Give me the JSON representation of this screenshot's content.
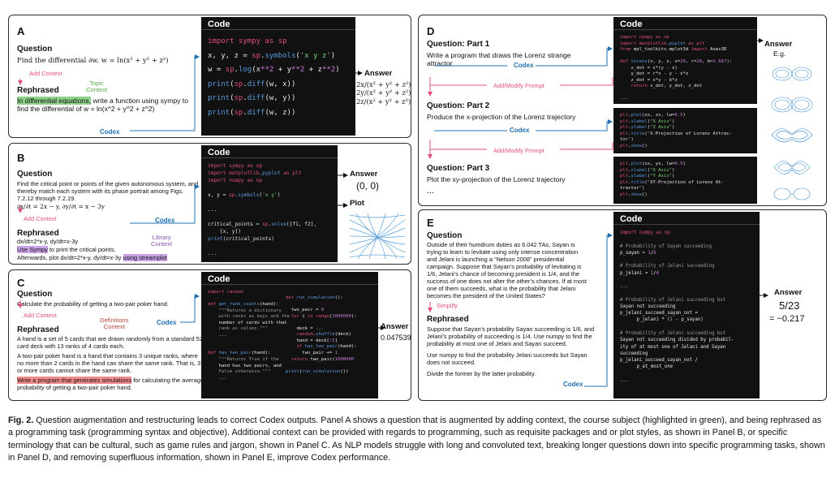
{
  "common": {
    "question": "Question",
    "rephrased": "Rephrased",
    "code": "Code",
    "answer": "Answer",
    "codex": "Codex",
    "add_context": "Add Context",
    "plot": "Plot"
  },
  "panelA": {
    "label": "A",
    "question": "Find the differential ∂w. w = ln(x² + y² + z²)",
    "topic": "Topic\nContext",
    "rephrased_hl": "In differential equations,",
    "rephrased_rest": " write a function using sympy to find the differential of w = ln(x^2 + y^2 + z^2)",
    "code": "import sympy as sp\nx, y, z = sp.symbols('x y z')\nw = sp.log(x**2 + y**2 + z**2)\nprint(sp.diff(w, x))\nprint(sp.diff(w, y))\nprint(sp.diff(w, z))",
    "answer": "2x/(x² + y² + z²)\n2y/(x² + y² + z²)\n2z/(x² + y² + z²)"
  },
  "panelB": {
    "label": "B",
    "question": "Find the critical point or points of the given autonomous system, and thereby match each system with its phase portrait among Figs. 7.2.12 through 7.2.19.",
    "equation": "∂x/∂t = 2x − y,  ∂y/∂t = x − 3y",
    "rephrased_1": "dx/dt=2*x-y, dy/dt=x-3y",
    "rephrased_hl1": "Use Sympy",
    "rephrased_2": " to print the critical points.",
    "rephrased_3": "Afterwards, plot dx/dt=2*x-y, dy/dt=x-3y ",
    "rephrased_hl2": "using streamplot",
    "library": "Library\nContext",
    "code": "import sympy as sp\nimport matplotlib.pyplot as plt\nimport numpy as np\n\nx, y = sp.symbols('x y')\n\n...\n\ncritical_points = sp.solve([f1, f2],\n    [x, y])\nprint(critical_points)\n\n...\n\nplt.streamplot(x_mesh, y_mesh, dx, dy)",
    "answer": "(0, 0)"
  },
  "panelC": {
    "label": "C",
    "question": "Calculate the probability of getting a two-pair poker hand.",
    "definitions": "Definitions\nContext",
    "rephrased_1": "A hand is a set of 5 cards that are drawn randomly from a standard 52 card deck with 13 ranks of 4 cards each.",
    "rephrased_2": "A two-pair poker hand is a hand that contains 3 unique ranks, where no more than 2 cards in the hand can share the same rank. That is, 3 or more cards cannot share the same rank.",
    "rephrased_hl": "Write a program that generates simulations",
    "rephrased_3": " for calculating the average probability of getting a two-pair poker hand.",
    "code_left": "import random\n\ndef get_rank_counts(hand):\n    \"\"\"Returns a dictionary\n    with ranks as keys and the\n    number of cards with that\n    rank as values.\"\"\"\n    ...\n\n\ndef has_two_pair(hand):\n    \"\"\"Returns True if the\n    hand has two pairs, and\n    False otherwise.\"\"\"\n    ...",
    "code_right": "\n\ndef run_simulation():\n\n  two_pair = 0\n  for i in range(1000000):\n\n    deck = ...\n    random.shuffle(deck)\n    hand = deck[:5]\n    if has_two_pair(hand):\n      two_pair += 1\n  return two_pair/1000000\n\nprint(run_simulation())",
    "answer": "0.047539"
  },
  "panelD": {
    "label": "D",
    "q1_head": "Question: Part 1",
    "q1": "Write a program that draws the Lorenz strange attractor",
    "q2_head": "Question: Part 2",
    "q2": "Produce the x-projection of the Lorenz trajectory",
    "q3_head": "Question: Part 3",
    "q3": "Plot the xy-projection of the Lorenz trajectory",
    "ellipsis": "...",
    "add_modify": "Add/Modify Prompt",
    "answer_eg": "E.g.",
    "code1": "import numpy as np\nimport matplotlib.pyplot as plt\nfrom mpl_toolkits.mplot3d import Axes3D\n\ndef lorenz(x, y, z, s=10, r=28, b=2.667):\n    x_dot = s*(y - x)\n    y_dot = r*x - y - x*z\n    z_dot = x*y - b*z\n    return x_dot, y_dot, z_dot\n\n...",
    "code2": "plt.plot(xs, zs, lw=0.5)\nplt.xlabel(\"X Axis\")\nplt.ylabel(\"Z Axis\")\nplt.title(\"X-Projection of Lorenz Attrac-\ntor\")\nplt.show()",
    "code3": "plt.plot(xs, ys, lw=0.5)\nplt.xlabel(\"X Axis\")\nplt.ylabel(\"Y Axis\")\nplt.title(\"XY-Projection of Lorenz At-\ntractor\")\nplt.show()"
  },
  "panelE": {
    "label": "E",
    "question": "Outside of their humdrum duties as 6.042 TAs, Sayan is trying to learn to levitate using only intense concentration and Jelani is launching a “Nelson 2008” presidential campaign. Suppose that Sayan’s probability of levitating is 1/6, Jelani’s chance of becoming president is 1/4, and the success of one does not alter the other’s chances. If at most one of them succeeds, what is the probability that Jelani becomes the president of the United States?",
    "simplify": "Simplify",
    "rephrased_1": "Suppose that Sayan’s probability Sayan succeeding is 1/6, and Jelani’s probability of succeeding is 1/4. Use numpy to find the probability at most one of Jelani and Sayan succeed.",
    "rephrased_2": "Use numpy to find the probability Jelani succeeds but Sayan does not succeed.",
    "rephrased_3": "Divide the former by the latter probability.",
    "code": "import numpy as np\n\n# Probability of Sayan succeeding\np_sayan = 1/6\n\n# Probability of Jelani succeeding\np_jelani = 1/4\n\n...\n\n# Probability of Jelani succeeding but\nSayan not succeeding\np_jelani_succeed_sayan_not =\n      p_jelani * (1 - p_sayan)\n\n# Probability of Jelani succeeding but\nSayan not succeeding divided by probabil-\nity of at most one of Jelani and Sayan\nsucceeding\np_jelani_succeed_sayan_not /\n      p_at_most_one\n\n...",
    "answer_frac": "5/23",
    "answer_approx": "= ~0.217"
  },
  "caption": {
    "label": "Fig. 2.",
    "text": " Question augmentation and restructuring leads to correct Codex outputs. Panel A shows a question that is augmented by adding context, the course subject (highlighted in green), and being rephrased as a programming task (programming syntax and objective). Additional context can be provided with regards to programming, such as requisite packages and or plot styles, as shown in Panel B, or specific terminology that can be cultural, such as game rules and jargon, shown in Panel C. As NLP models struggle with long and convoluted text, breaking longer questions down into specific programming tasks, shown in Panel D, and removing superfluous information, shown in Panel E, improve Codex performance."
  },
  "colors": {
    "code_bg": "#111111",
    "keyword": "#e0507a",
    "number": "#c77dd6",
    "func": "#5b9be0",
    "string": "#7fd37b",
    "comment": "#9a9a9a",
    "codex_blue": "#1f6fb0",
    "pink": "#e0507a"
  }
}
